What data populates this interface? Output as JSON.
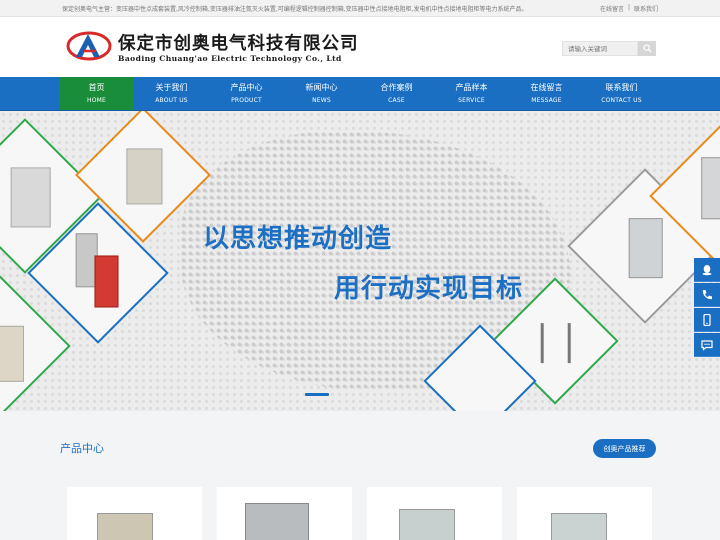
{
  "topbar": {
    "intro": "保定创奥电气主营：变压器中性点成套装置,风冷控制箱,变压器排油注氮灭火装置,可编程逻辑控制器控制箱,变压器中性点接地电阻柜,发电机中性点接地电阻柜等电力系统产品。",
    "link_message": "在线留言",
    "separator": "|",
    "link_contact": "联系我们"
  },
  "header": {
    "company_cn": "保定市创奥电气科技有限公司",
    "company_en": "Baoding Chuang'ao Electric Technology Co., Ltd",
    "search_placeholder": "请输入关键词",
    "logo_color_red": "#d82a2a",
    "logo_color_blue": "#1b5fb0"
  },
  "nav": [
    {
      "cn": "首页",
      "en": "HOME",
      "active": true
    },
    {
      "cn": "关于我们",
      "en": "ABOUT US"
    },
    {
      "cn": "产品中心",
      "en": "PRODUCT"
    },
    {
      "cn": "新闻中心",
      "en": "NEWS"
    },
    {
      "cn": "合作案例",
      "en": "CASE"
    },
    {
      "cn": "产品样本",
      "en": "SERVICE"
    },
    {
      "cn": "在线留言",
      "en": "MESSAGE"
    },
    {
      "cn": "联系我们",
      "en": "CONTACT US"
    }
  ],
  "banner": {
    "slogan_line1": "以思想推动创造",
    "slogan_line2": "用行动实现目标"
  },
  "products": {
    "title": "产品中心",
    "button": "创奥产品推荐"
  },
  "colors": {
    "primary": "#1b6fc2",
    "nav_active": "#1a8d3a",
    "accent_orange": "#e88a1a"
  },
  "float_icons": [
    "qq-icon",
    "phone-icon",
    "mobile-icon",
    "message-icon"
  ]
}
